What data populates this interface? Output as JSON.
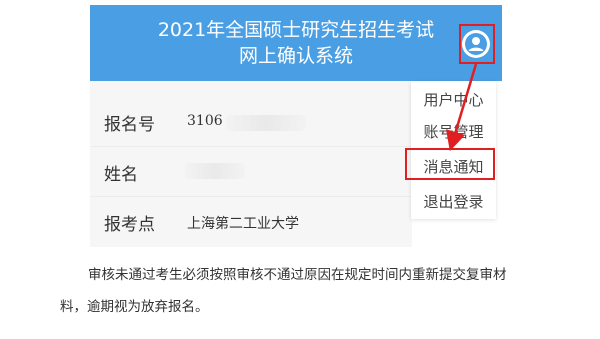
{
  "header": {
    "title_line1": "2021年全国硕士研究生招生考试",
    "title_line2": "网上确认系统"
  },
  "icons": {
    "user": "user-circle-icon"
  },
  "colors": {
    "header_bg": "#4a9fe4",
    "highlight": "#e02020"
  },
  "profile": {
    "reg_no_label": "报名号",
    "reg_no_value": "3106",
    "name_label": "姓名",
    "name_value": "",
    "site_label": "报考点",
    "site_value": "上海第二工业大学"
  },
  "menu": {
    "items": [
      "用户中心",
      "账号管理",
      "消息通知",
      "退出登录"
    ]
  },
  "notice": {
    "line1": "审核未通过考生必须按照审核不通过原因在规定时间内重新提交复审材",
    "line2": "料，逾期视为放弃报名。"
  }
}
